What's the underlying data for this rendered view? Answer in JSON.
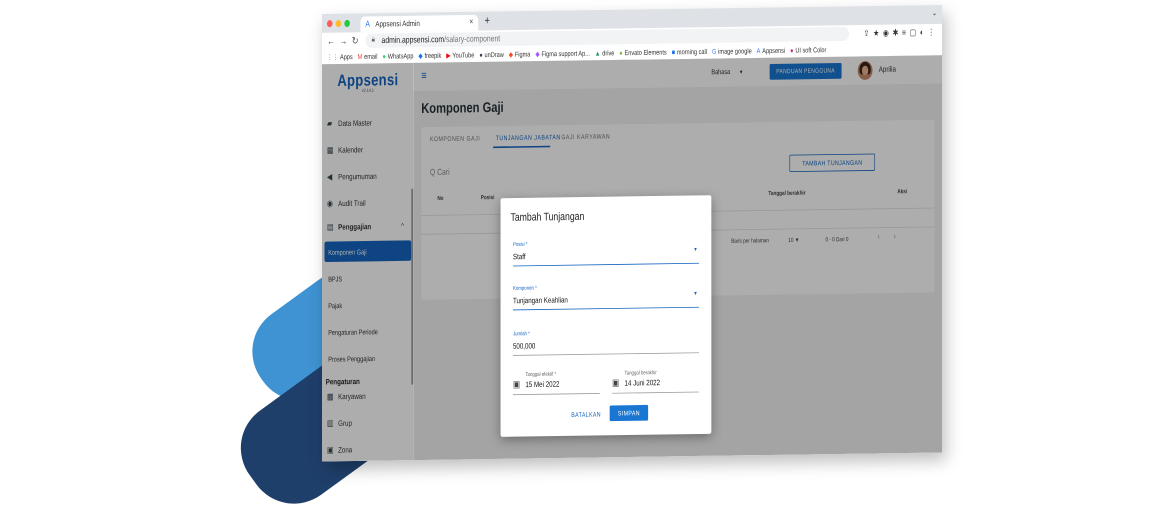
{
  "browser": {
    "tab_title": "Appsensi Admin",
    "tab_icon": "appsensi-logo-icon",
    "tab_close": "×",
    "new_tab": "+",
    "tabs_chevron": "⌄",
    "url_host": "admin.appsensi.com",
    "url_path": "/salary-component",
    "bookmarks": [
      {
        "label": "Apps",
        "icon": "⋮⋮",
        "color": "#4285f4"
      },
      {
        "label": "email",
        "icon": "M",
        "color": "#ea4335"
      },
      {
        "label": "WhatsApp",
        "icon": "●",
        "color": "#25d366"
      },
      {
        "label": "freepik",
        "icon": "◆",
        "color": "#1273eb"
      },
      {
        "label": "YouTube",
        "icon": "▶",
        "color": "#ff0000"
      },
      {
        "label": "unDraw",
        "icon": "●",
        "color": "#3f3d56"
      },
      {
        "label": "Figma",
        "icon": "◆",
        "color": "#f24e1e"
      },
      {
        "label": "Figma support Ap...",
        "icon": "◆",
        "color": "#a259ff"
      },
      {
        "label": "drive",
        "icon": "▲",
        "color": "#0f9d58"
      },
      {
        "label": "Envato Elements",
        "icon": "●",
        "color": "#82b541"
      },
      {
        "label": "morning call",
        "icon": "■",
        "color": "#1a73e8"
      },
      {
        "label": "image google",
        "icon": "G",
        "color": "#4285f4"
      },
      {
        "label": "Appsensi",
        "icon": "A",
        "color": "#2979ff"
      },
      {
        "label": "UI soft Color",
        "icon": "●",
        "color": "#c13584"
      }
    ]
  },
  "sidebar": {
    "logo": "Appsensi",
    "version": "v2.14.1",
    "items": [
      {
        "label": "Data Master",
        "icon": "▰"
      },
      {
        "label": "Kalender",
        "icon": "▦"
      },
      {
        "label": "Pengumuman",
        "icon": "◀"
      },
      {
        "label": "Audit Trail",
        "icon": "◉"
      }
    ],
    "section_penggajian": {
      "label": "Penggajian",
      "icon": "▤",
      "chevron": "^"
    },
    "sub_items": [
      {
        "label": "Komponen Gaji"
      },
      {
        "label": "BPJS"
      },
      {
        "label": "Pajak"
      },
      {
        "label": "Pengaturan Periode"
      },
      {
        "label": "Proses Penggajian"
      }
    ],
    "section_pengaturan": "Pengaturan",
    "items2": [
      {
        "label": "Karyawan",
        "icon": "▩"
      },
      {
        "label": "Grup",
        "icon": "▥"
      },
      {
        "label": "Zona",
        "icon": "▣"
      }
    ]
  },
  "topbar": {
    "menu_icon": "≡",
    "language": "Bahasa",
    "language_caret": "▼",
    "guide_button": "PANDUAN PENGGUNA",
    "user_name": "Aprilia"
  },
  "page": {
    "title": "Komponen Gaji",
    "tabs": [
      "KOMPONEN GAJI",
      "TUNJANGAN JABATAN",
      "GAJI KARYAWAN"
    ],
    "search_placeholder": "Q Cari",
    "add_button": "TAMBAH TUNJANGAN",
    "columns": [
      "No",
      "Posisi",
      "Tanggal berakhir",
      "Aksi"
    ],
    "rows_per_page_label": "Baris per halaman",
    "rows_per_page": "10",
    "rows_caret": "▼",
    "range": "0 - 0 Dari 0",
    "prev": "‹",
    "next": "›"
  },
  "dialog": {
    "title": "Tambah Tunjangan",
    "posisi_label": "Posisi *",
    "posisi_value": "Staff",
    "komponen_label": "Komponen *",
    "komponen_value": "Tunjangan Keahlian",
    "jumlah_label": "Jumlah *",
    "jumlah_value": "500,000",
    "tgl_efektif_label": "Tanggal efektif *",
    "tgl_efektif_value": "15 Mei 2022",
    "tgl_berakhir_label": "Tanggal berakhir",
    "tgl_berakhir_value": "14 Juni 2022",
    "caret": "▼",
    "calendar_icon": "▣",
    "cancel_button": "BATALKAN",
    "save_button": "SIMPAN"
  },
  "colors": {
    "primary": "#1976d2",
    "primary_dark": "#1565c0",
    "deco_light": "#3f93d3",
    "deco_dark": "#1f3f6b"
  }
}
